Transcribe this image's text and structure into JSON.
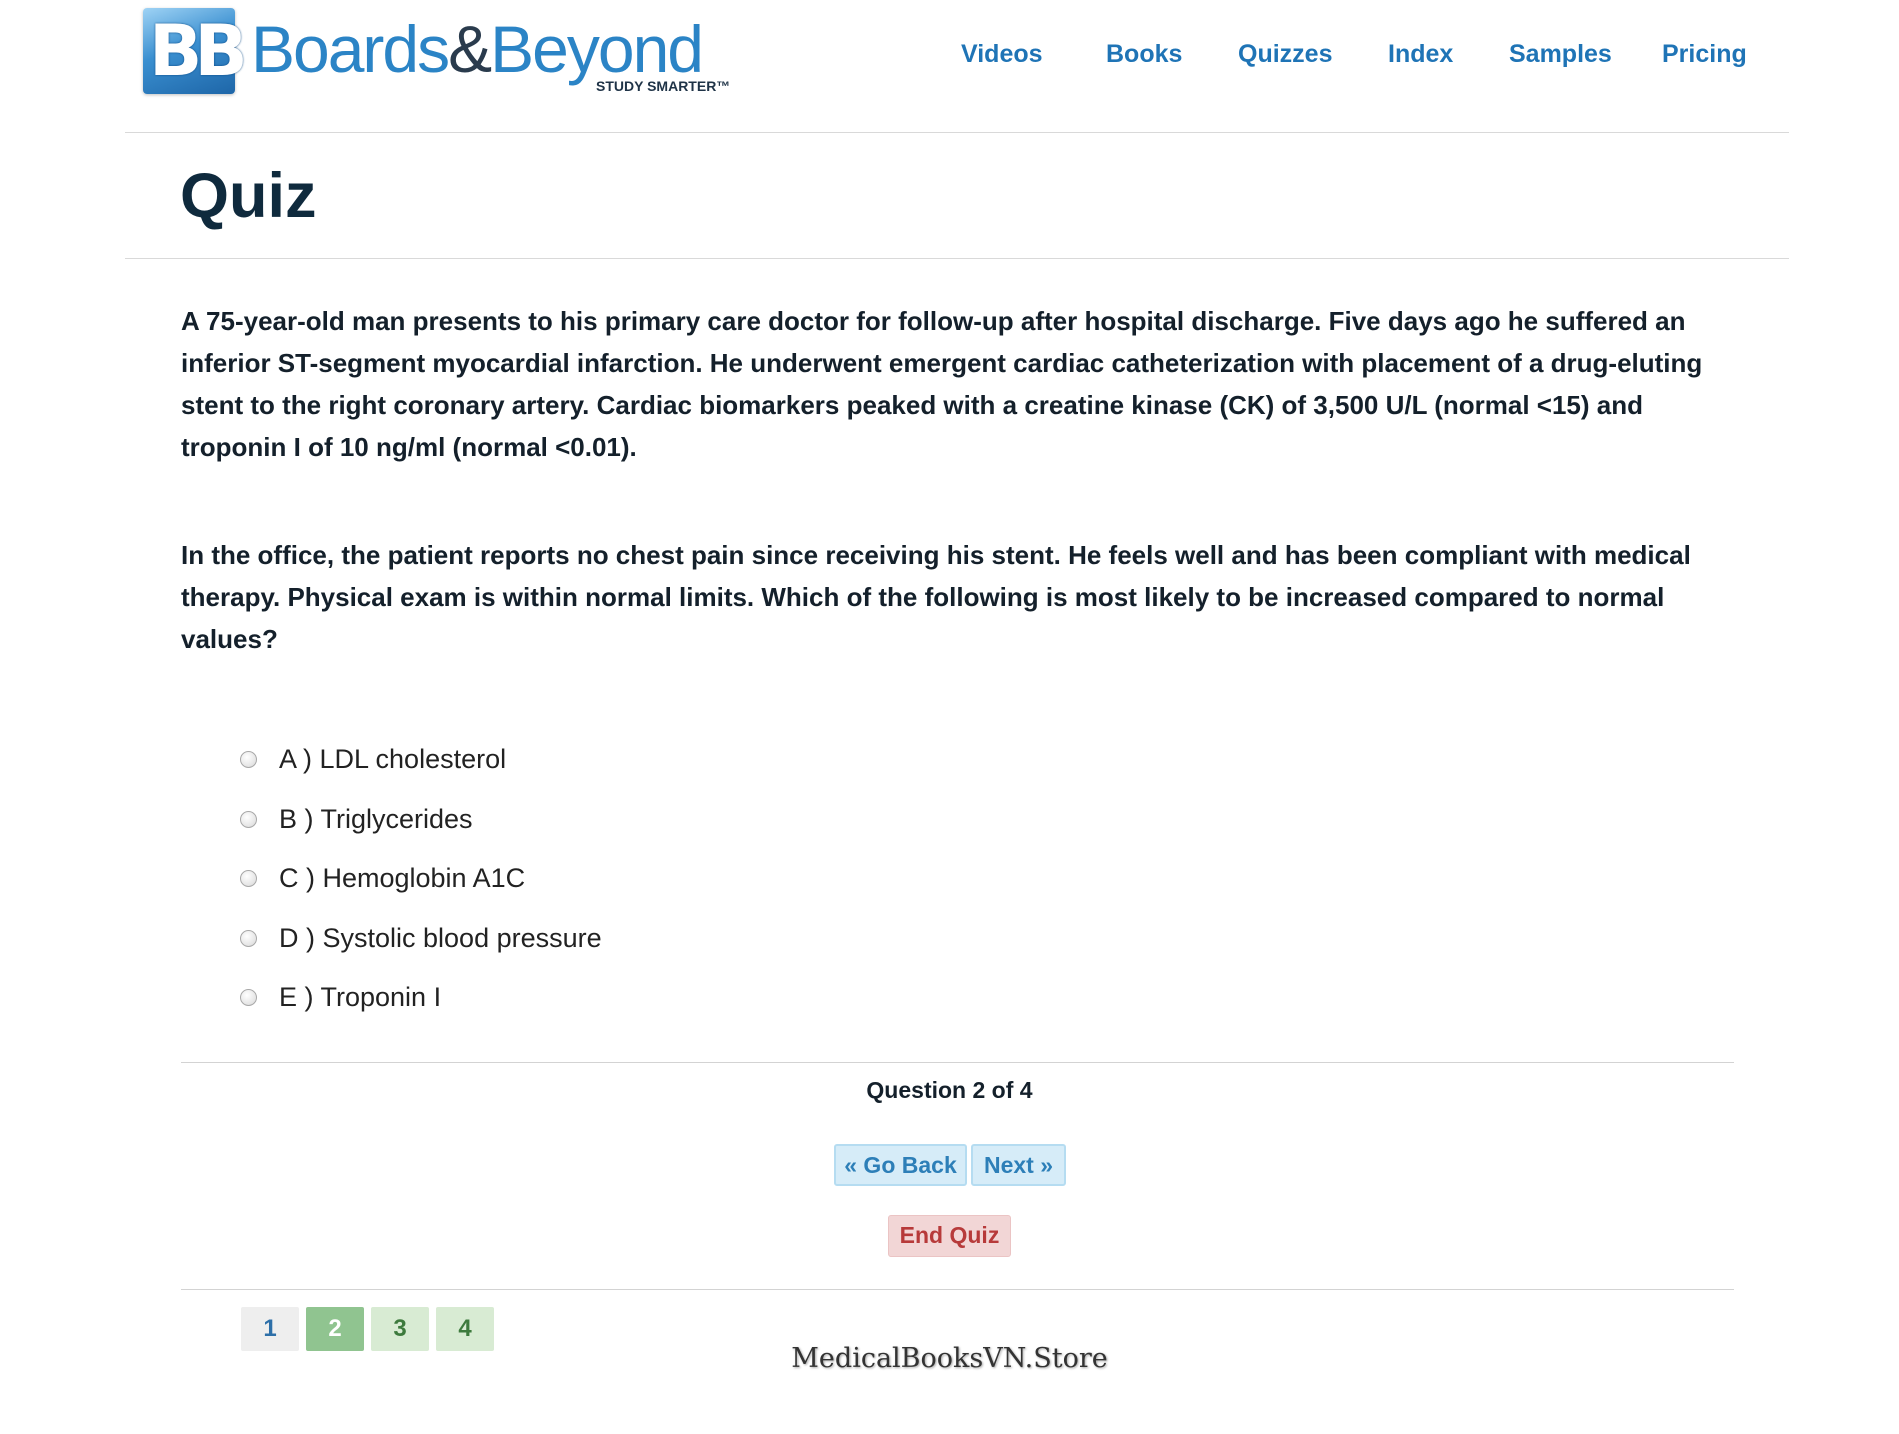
{
  "header": {
    "logo": {
      "badge": "BB",
      "brand_main": "Boards",
      "brand_amp": "&",
      "brand_end": "Beyond",
      "tagline": "STUDY SMARTER™"
    },
    "nav": [
      "Videos",
      "Books",
      "Quizzes",
      "Index",
      "Samples",
      "Pricing"
    ]
  },
  "page": {
    "title": "Quiz"
  },
  "question": {
    "paragraphs": [
      "A 75-year-old man presents to his primary care doctor for follow-up after hospital discharge. Five days ago he suffered an inferior ST-segment myocardial infarction. He underwent emergent cardiac catheterization with placement of a drug-eluting stent to the right coronary artery. Cardiac biomarkers peaked with a creatine kinase (CK) of 3,500 U/L (normal <15) and troponin I of 10 ng/ml (normal <0.01).",
      "In the office, the patient reports no chest pain since receiving his stent. He feels well and has been compliant with medical therapy. Physical exam is within normal limits. Which of the following is most likely to be increased compared to normal values?"
    ],
    "options": [
      "A ) LDL cholesterol",
      "B ) Triglycerides",
      "C ) Hemoglobin A1C",
      "D ) Systolic blood pressure",
      "E ) Troponin I"
    ]
  },
  "navigation": {
    "counter": "Question 2 of 4",
    "go_back": "« Go Back",
    "next": "Next »",
    "end_quiz": "End Quiz",
    "pages": [
      "1",
      "2",
      "3",
      "4"
    ],
    "current_page": "2"
  },
  "watermark": "MedicalBooksVN.Store"
}
